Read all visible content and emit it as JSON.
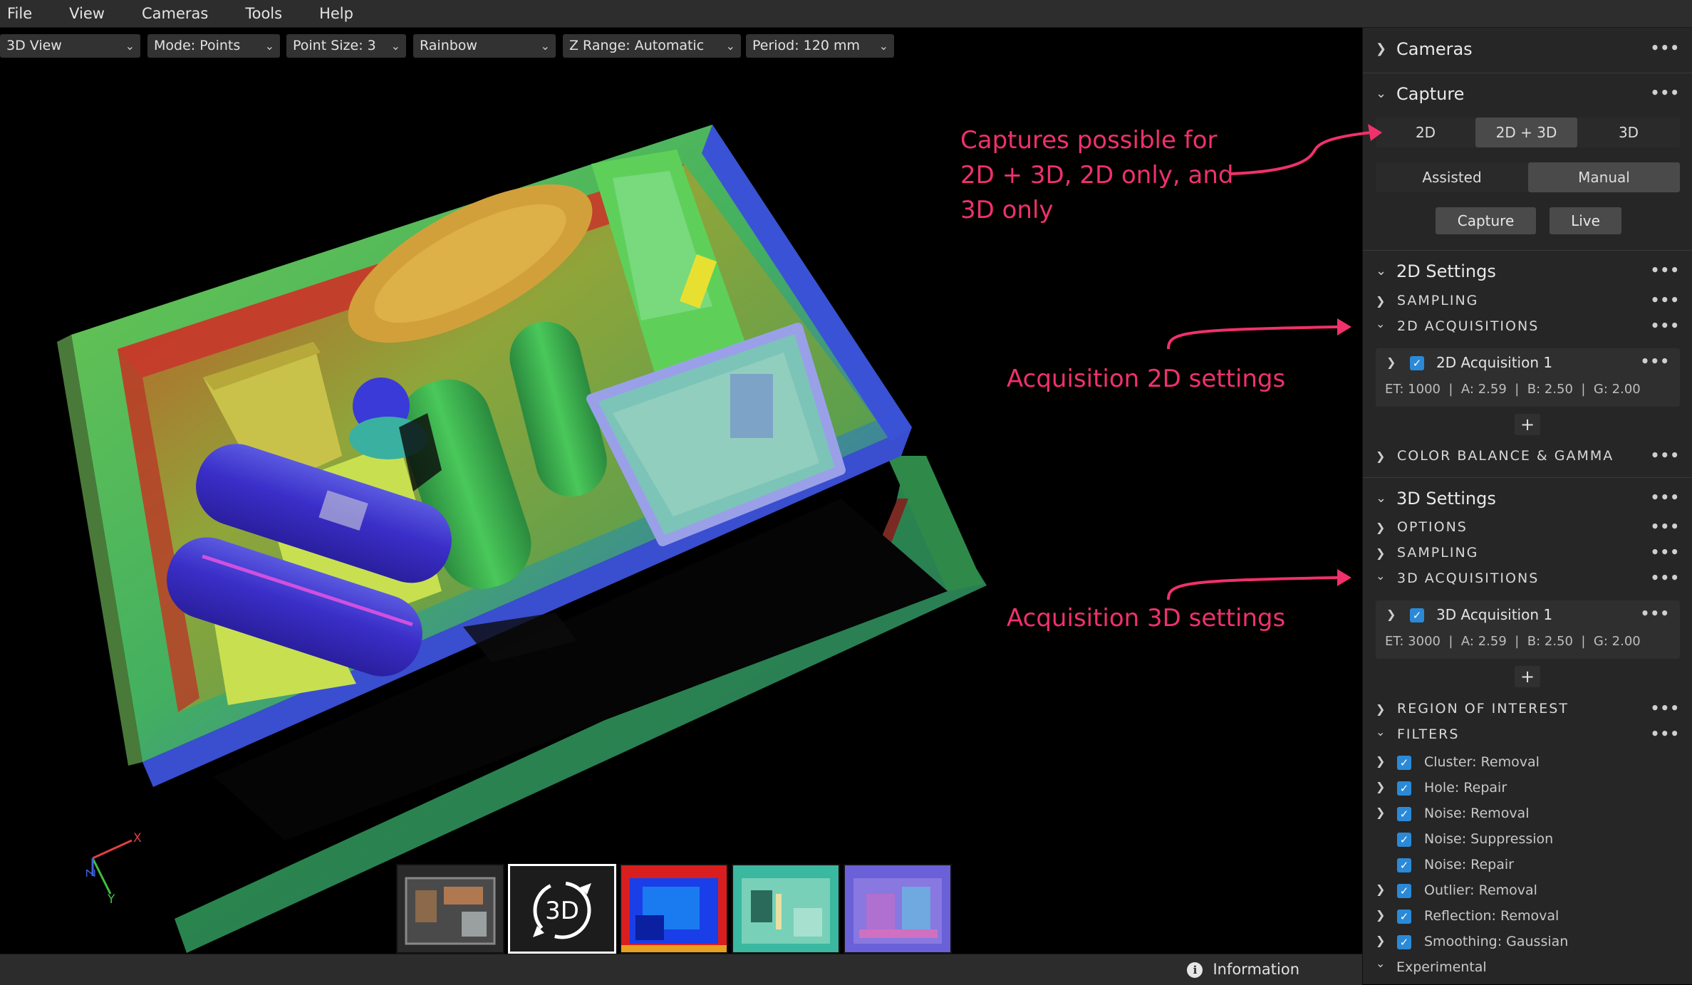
{
  "menubar": {
    "items": [
      "File",
      "View",
      "Cameras",
      "Tools",
      "Help"
    ]
  },
  "toolbar": {
    "view_mode": "3D View",
    "render_mode": "Mode: Points",
    "point_size": "Point Size: 3",
    "colormap": "Rainbow",
    "z_range": "Z Range: Automatic",
    "period": "Period: 120 mm"
  },
  "axes": {
    "x": "X",
    "y": "Y",
    "z": "Z"
  },
  "thumbnails": {
    "items": [
      "color-2d",
      "3D",
      "depth",
      "snr",
      "normals"
    ],
    "active": "3D",
    "active_label": "3D"
  },
  "statusbar": {
    "info_label": "Information"
  },
  "panel": {
    "cameras": {
      "title": "Cameras"
    },
    "capture": {
      "title": "Capture",
      "modes": [
        "2D",
        "2D + 3D",
        "3D"
      ],
      "selected_mode": "2D + 3D",
      "assist": [
        "Assisted",
        "Manual"
      ],
      "selected_assist": "Manual",
      "capture_btn": "Capture",
      "live_btn": "Live"
    },
    "settings_2d": {
      "title": "2D Settings",
      "sampling": "SAMPLING",
      "acquisitions": "2D ACQUISITIONS",
      "acq_name": "2D Acquisition 1",
      "acq_params": "ET: 1000  |  A: 2.59  |  B: 2.50  |  G: 2.00",
      "color_balance": "COLOR BALANCE & GAMMA"
    },
    "settings_3d": {
      "title": "3D Settings",
      "options": "OPTIONS",
      "sampling": "SAMPLING",
      "acquisitions": "3D ACQUISITIONS",
      "acq_name": "3D Acquisition 1",
      "acq_params": "ET: 3000  |  A: 2.59  |  B: 2.50  |  G: 2.00",
      "roi": "REGION OF INTEREST",
      "filters": "FILTERS",
      "filter_items": [
        "Cluster: Removal",
        "Hole: Repair",
        "Noise: Removal",
        "Noise: Suppression",
        "Noise: Repair",
        "Outlier: Removal",
        "Reflection: Removal",
        "Smoothing: Gaussian"
      ],
      "experimental": "Experimental"
    },
    "plus": "+"
  },
  "annotations": {
    "capture_note_l1": "Captures possible for",
    "capture_note_l2": "2D + 3D, 2D only, and",
    "capture_note_l3": "3D only",
    "acq2d_note": "Acquisition 2D settings",
    "acq3d_note": "Acquisition 3D settings"
  },
  "colors": {
    "annotation": "#f0316c",
    "checkbox": "#2b8ad8",
    "panel_bg": "#262626"
  }
}
